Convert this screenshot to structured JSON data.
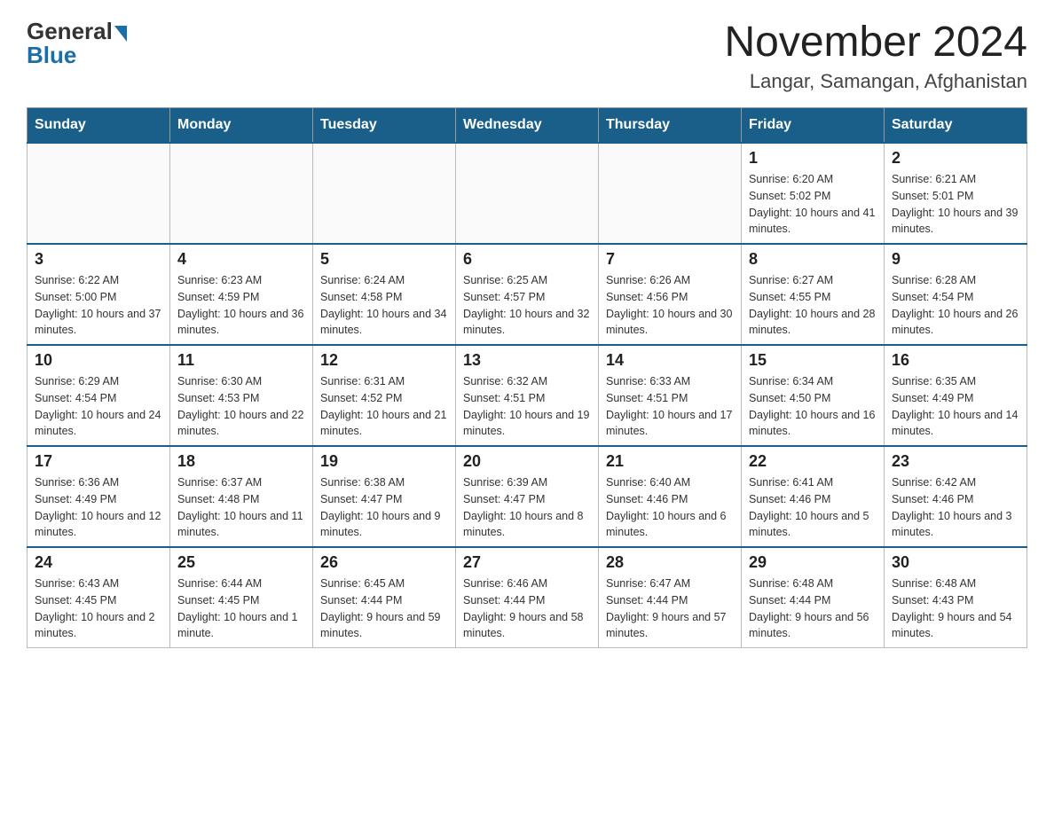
{
  "header": {
    "logo_general": "General",
    "logo_blue": "Blue",
    "title": "November 2024",
    "subtitle": "Langar, Samangan, Afghanistan"
  },
  "calendar": {
    "days_of_week": [
      "Sunday",
      "Monday",
      "Tuesday",
      "Wednesday",
      "Thursday",
      "Friday",
      "Saturday"
    ],
    "weeks": [
      [
        {
          "day": "",
          "info": ""
        },
        {
          "day": "",
          "info": ""
        },
        {
          "day": "",
          "info": ""
        },
        {
          "day": "",
          "info": ""
        },
        {
          "day": "",
          "info": ""
        },
        {
          "day": "1",
          "info": "Sunrise: 6:20 AM\nSunset: 5:02 PM\nDaylight: 10 hours and 41 minutes."
        },
        {
          "day": "2",
          "info": "Sunrise: 6:21 AM\nSunset: 5:01 PM\nDaylight: 10 hours and 39 minutes."
        }
      ],
      [
        {
          "day": "3",
          "info": "Sunrise: 6:22 AM\nSunset: 5:00 PM\nDaylight: 10 hours and 37 minutes."
        },
        {
          "day": "4",
          "info": "Sunrise: 6:23 AM\nSunset: 4:59 PM\nDaylight: 10 hours and 36 minutes."
        },
        {
          "day": "5",
          "info": "Sunrise: 6:24 AM\nSunset: 4:58 PM\nDaylight: 10 hours and 34 minutes."
        },
        {
          "day": "6",
          "info": "Sunrise: 6:25 AM\nSunset: 4:57 PM\nDaylight: 10 hours and 32 minutes."
        },
        {
          "day": "7",
          "info": "Sunrise: 6:26 AM\nSunset: 4:56 PM\nDaylight: 10 hours and 30 minutes."
        },
        {
          "day": "8",
          "info": "Sunrise: 6:27 AM\nSunset: 4:55 PM\nDaylight: 10 hours and 28 minutes."
        },
        {
          "day": "9",
          "info": "Sunrise: 6:28 AM\nSunset: 4:54 PM\nDaylight: 10 hours and 26 minutes."
        }
      ],
      [
        {
          "day": "10",
          "info": "Sunrise: 6:29 AM\nSunset: 4:54 PM\nDaylight: 10 hours and 24 minutes."
        },
        {
          "day": "11",
          "info": "Sunrise: 6:30 AM\nSunset: 4:53 PM\nDaylight: 10 hours and 22 minutes."
        },
        {
          "day": "12",
          "info": "Sunrise: 6:31 AM\nSunset: 4:52 PM\nDaylight: 10 hours and 21 minutes."
        },
        {
          "day": "13",
          "info": "Sunrise: 6:32 AM\nSunset: 4:51 PM\nDaylight: 10 hours and 19 minutes."
        },
        {
          "day": "14",
          "info": "Sunrise: 6:33 AM\nSunset: 4:51 PM\nDaylight: 10 hours and 17 minutes."
        },
        {
          "day": "15",
          "info": "Sunrise: 6:34 AM\nSunset: 4:50 PM\nDaylight: 10 hours and 16 minutes."
        },
        {
          "day": "16",
          "info": "Sunrise: 6:35 AM\nSunset: 4:49 PM\nDaylight: 10 hours and 14 minutes."
        }
      ],
      [
        {
          "day": "17",
          "info": "Sunrise: 6:36 AM\nSunset: 4:49 PM\nDaylight: 10 hours and 12 minutes."
        },
        {
          "day": "18",
          "info": "Sunrise: 6:37 AM\nSunset: 4:48 PM\nDaylight: 10 hours and 11 minutes."
        },
        {
          "day": "19",
          "info": "Sunrise: 6:38 AM\nSunset: 4:47 PM\nDaylight: 10 hours and 9 minutes."
        },
        {
          "day": "20",
          "info": "Sunrise: 6:39 AM\nSunset: 4:47 PM\nDaylight: 10 hours and 8 minutes."
        },
        {
          "day": "21",
          "info": "Sunrise: 6:40 AM\nSunset: 4:46 PM\nDaylight: 10 hours and 6 minutes."
        },
        {
          "day": "22",
          "info": "Sunrise: 6:41 AM\nSunset: 4:46 PM\nDaylight: 10 hours and 5 minutes."
        },
        {
          "day": "23",
          "info": "Sunrise: 6:42 AM\nSunset: 4:46 PM\nDaylight: 10 hours and 3 minutes."
        }
      ],
      [
        {
          "day": "24",
          "info": "Sunrise: 6:43 AM\nSunset: 4:45 PM\nDaylight: 10 hours and 2 minutes."
        },
        {
          "day": "25",
          "info": "Sunrise: 6:44 AM\nSunset: 4:45 PM\nDaylight: 10 hours and 1 minute."
        },
        {
          "day": "26",
          "info": "Sunrise: 6:45 AM\nSunset: 4:44 PM\nDaylight: 9 hours and 59 minutes."
        },
        {
          "day": "27",
          "info": "Sunrise: 6:46 AM\nSunset: 4:44 PM\nDaylight: 9 hours and 58 minutes."
        },
        {
          "day": "28",
          "info": "Sunrise: 6:47 AM\nSunset: 4:44 PM\nDaylight: 9 hours and 57 minutes."
        },
        {
          "day": "29",
          "info": "Sunrise: 6:48 AM\nSunset: 4:44 PM\nDaylight: 9 hours and 56 minutes."
        },
        {
          "day": "30",
          "info": "Sunrise: 6:48 AM\nSunset: 4:43 PM\nDaylight: 9 hours and 54 minutes."
        }
      ]
    ]
  }
}
